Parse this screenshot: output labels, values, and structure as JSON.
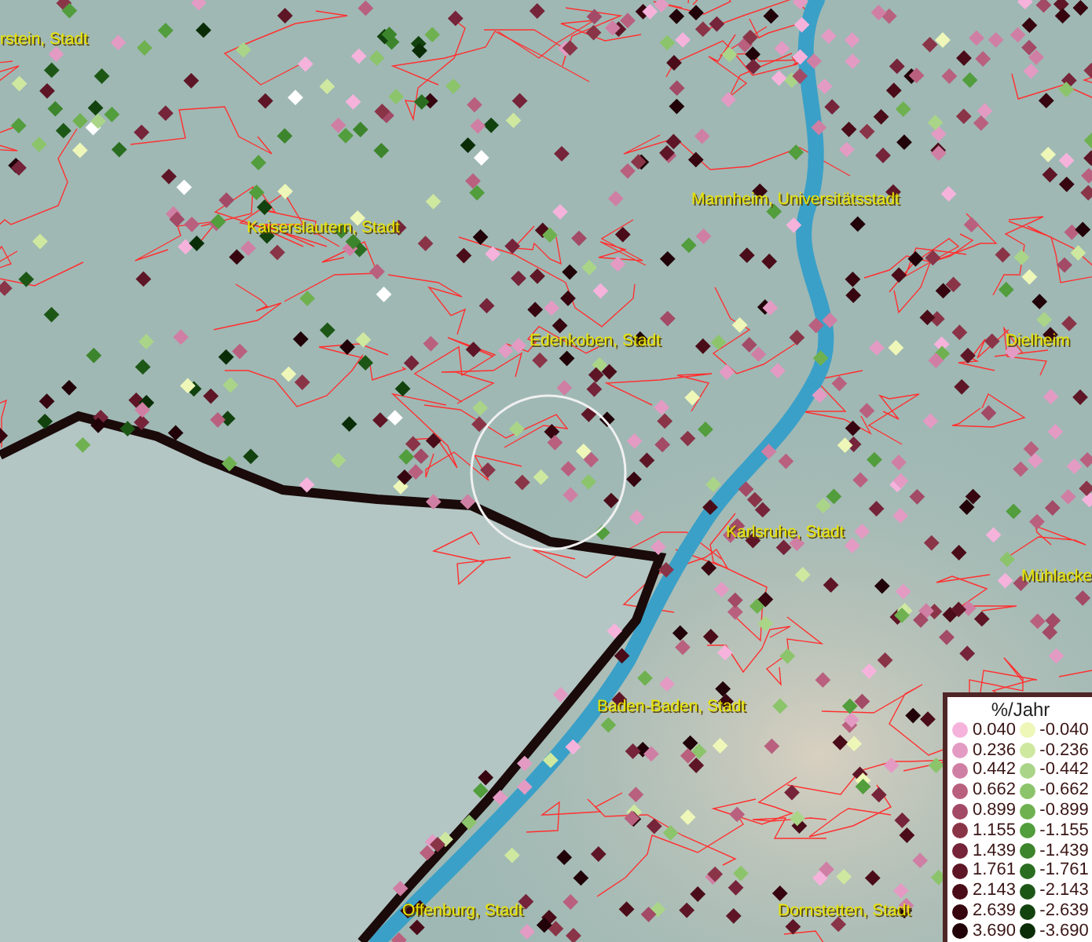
{
  "places": [
    {
      "label": "rstein, Stadt"
    },
    {
      "label": "Kaiserslautern, Stadt"
    },
    {
      "label": "Mannheim, Universitätsstadt"
    },
    {
      "label": "Edenkoben, Stadt"
    },
    {
      "label": "Dielheim"
    },
    {
      "label": "Karlsruhe, Stadt"
    },
    {
      "label": "Mühlacke"
    },
    {
      "label": "Baden-Baden, Stadt"
    },
    {
      "label": "Offenburg, Stadt"
    },
    {
      "label": "Dornstetten, Stadt"
    }
  ],
  "legend": {
    "title": "%/Jahr",
    "rise": [
      {
        "value": "0.040",
        "color": "#f5b3dc"
      },
      {
        "value": "0.236",
        "color": "#e39bc4"
      },
      {
        "value": "0.442",
        "color": "#d07fa4"
      },
      {
        "value": "0.662",
        "color": "#b9607f"
      },
      {
        "value": "0.899",
        "color": "#a24a66"
      },
      {
        "value": "1.155",
        "color": "#8a3448"
      },
      {
        "value": "1.439",
        "color": "#75243a"
      },
      {
        "value": "1.761",
        "color": "#5e1626"
      },
      {
        "value": "2.143",
        "color": "#4a0c18"
      },
      {
        "value": "2.639",
        "color": "#360510"
      },
      {
        "value": "3.690",
        "color": "#200208"
      }
    ],
    "fall": [
      {
        "value": "-0.040",
        "color": "#eef7b8"
      },
      {
        "value": "-0.236",
        "color": "#cfe8a0"
      },
      {
        "value": "-0.442",
        "color": "#aad588"
      },
      {
        "value": "-0.662",
        "color": "#8cc46c"
      },
      {
        "value": "-0.899",
        "color": "#6fb150"
      },
      {
        "value": "-1.155",
        "color": "#529d3c"
      },
      {
        "value": "-1.439",
        "color": "#3d852c"
      },
      {
        "value": "-1.761",
        "color": "#2a6d20"
      },
      {
        "value": "-2.143",
        "color": "#1d5716"
      },
      {
        "value": "-2.639",
        "color": "#12420e"
      },
      {
        "value": "-3.690",
        "color": "#0a2d08"
      }
    ]
  }
}
